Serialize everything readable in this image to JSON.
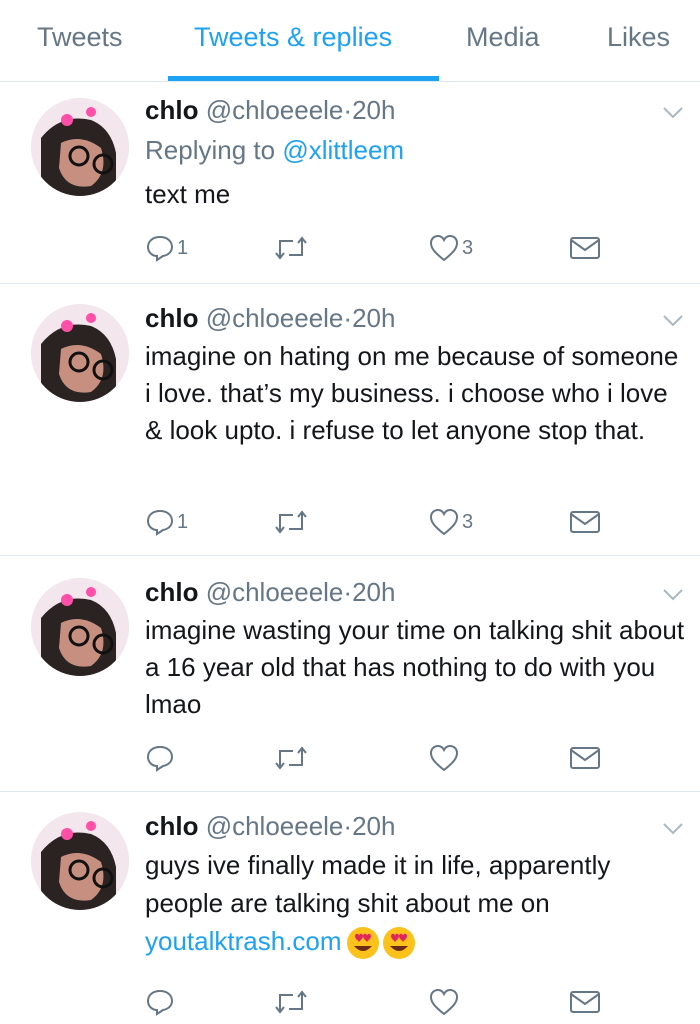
{
  "tabs": [
    {
      "label": "Tweets",
      "active": false
    },
    {
      "label": "Tweets & replies",
      "active": true
    },
    {
      "label": "Media",
      "active": false
    },
    {
      "label": "Likes",
      "active": false
    }
  ],
  "colors": {
    "accent": "#1da1f2",
    "muted": "#657786",
    "text": "#14171a",
    "divider": "#e1e8ed"
  },
  "tweets": [
    {
      "name": "chlo",
      "handle": "@chloeeele",
      "dot": "·",
      "time": "20h",
      "replying_prefix": "Replying to",
      "replying_to": "@xlittleem",
      "text": "text me",
      "reply_count": "1",
      "like_count": "3"
    },
    {
      "name": "chlo",
      "handle": "@chloeeele",
      "dot": "·",
      "time": "20h",
      "text": "imagine on hating on me because of someone i love. that’s my business. i choose who i love & look upto. i refuse to let anyone stop that.",
      "reply_count": "1",
      "like_count": "3"
    },
    {
      "name": "chlo",
      "handle": "@chloeeele",
      "dot": "·",
      "time": "20h",
      "text": "imagine wasting your time on talking shit about a 16 year old that has nothing to do with you lmao",
      "reply_count": "",
      "like_count": ""
    },
    {
      "name": "chlo",
      "handle": "@chloeeele",
      "dot": "·",
      "time": "20h",
      "text_before_link": "guys ive finally made it in life, apparently people are talking shit about me on",
      "link": "youtalktrash.com",
      "emoji": "heart-eyes-emoji",
      "reply_count": "",
      "like_count": ""
    }
  ],
  "icons": {
    "reply": "reply-icon",
    "retweet": "retweet-icon",
    "like": "heart-icon",
    "dm": "envelope-icon",
    "caret": "chevron-down-icon"
  }
}
